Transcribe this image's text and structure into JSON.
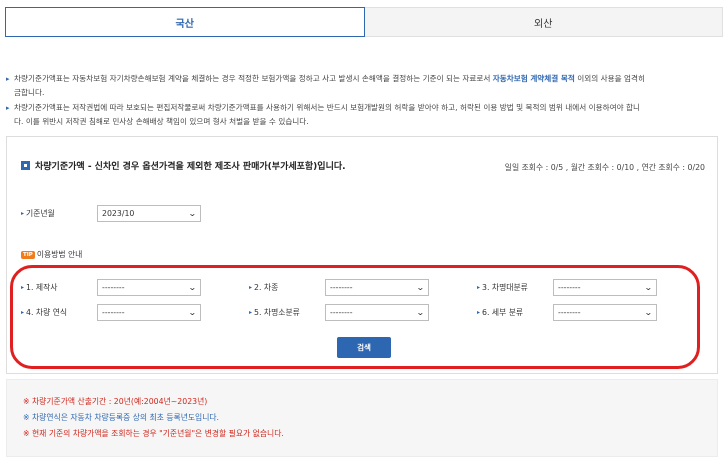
{
  "tabs": [
    {
      "label": "국산",
      "active": true
    },
    {
      "label": "외산",
      "active": false
    }
  ],
  "notes": {
    "line1_pre": "차량기준가액표는 자동차보험 자기차량손해보험 계약을 체결하는 경우 적정한 보험가액을 정하고 사고 발생시 손해액을 결정하는 기준이 되는 자료로서 ",
    "line1_hl": "자동차보험 계약체결 목적",
    "line1_post": " 이외의 사용을 엄격히",
    "line1_cont": "금합니다.",
    "line2": "차량기준가액표는 저작권법에 따라 보호되는 편집저작물로써 차량기준가액표를 사용하기 위해서는 반드시 보험개발원의 허락을 받아야 하고, 허락된 이용 방법 및 목적의 범위 내에서 이용하여야 합니",
    "line2_cont": "다. 이를 위반시 저작권 침해로 민사상 손해배상 책임이 있으며 형사 처벌을 받을 수 있습니다."
  },
  "panel": {
    "title": "차량기준가액 - 신차인 경우 옵션가격을 제외한 제조사 판매가(부가세포함)입니다.",
    "counts": "일일 조회수 : 0/5 , 월간 조회수 : 0/10 , 연간 조회수 : 0/20",
    "base_month_label": "기준년월",
    "base_month_value": "2023/10",
    "guide_badge": "TIP",
    "guide_label": "이용방법 안내",
    "filters": [
      {
        "label": "1. 제작사",
        "value": "--------"
      },
      {
        "label": "2. 차종",
        "value": "--------"
      },
      {
        "label": "3. 차명대분류",
        "value": "--------"
      },
      {
        "label": "4. 차량 연식",
        "value": "--------"
      },
      {
        "label": "5. 차명소분류",
        "value": "--------"
      },
      {
        "label": "6. 세부 분류",
        "value": "--------"
      }
    ],
    "search_label": "검색"
  },
  "footer": {
    "note1": "※ 차량기준가액 산출기간 : 20년(예:2004년~2023년)",
    "note2": "※ 차량연식은 자동차 차량등록증 상의 최초 등록년도입니다.",
    "note3": "※ 현재 기준의 차량가액을 조회하는 경우 \"기준년월\"은 변경할 필요가 없습니다."
  },
  "colors": {
    "accent": "#2f67b0",
    "highlight_frame": "#e02020",
    "warning_text": "#d0261c",
    "tip_badge": "#f07c1c"
  }
}
